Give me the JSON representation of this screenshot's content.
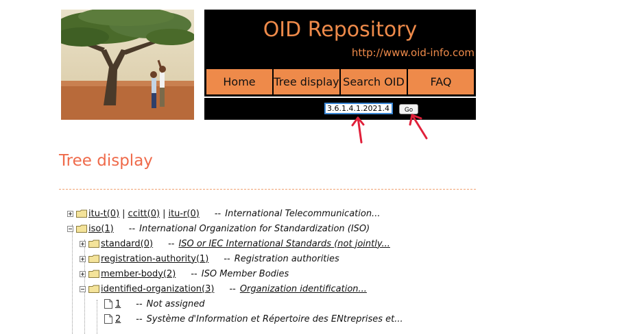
{
  "header": {
    "title": "OID Repository",
    "url": "http://www.oid-info.com"
  },
  "nav": {
    "items": [
      "Home",
      "Tree display",
      "Search OID",
      "FAQ"
    ]
  },
  "search": {
    "value": "3.6.1.4.1.2021.4.1",
    "go_label": "Go"
  },
  "page": {
    "title": "Tree display"
  },
  "tree": {
    "row0": {
      "links": [
        "itu-t(0)",
        "ccitt(0)",
        "itu-r(0)"
      ],
      "desc": "International Telecommunication..."
    },
    "row1": {
      "link": "iso(1)",
      "desc": "International Organization for Standardization (ISO)"
    },
    "row2": {
      "link": "standard(0)",
      "desc": "ISO or IEC International Standards (not jointly..."
    },
    "row3": {
      "link": "registration-authority(1)",
      "desc": "Registration authorities"
    },
    "row4": {
      "link": "member-body(2)",
      "desc": "ISO Member Bodies"
    },
    "row5": {
      "link": "identified-organization(3)",
      "desc": "Organization identification..."
    },
    "row6": {
      "link": "1",
      "desc": "Not assigned"
    },
    "row7": {
      "link": "2",
      "desc": "Système d'Information et Répertoire des ENtreprises et..."
    },
    "dash": "--"
  },
  "colors": {
    "accent": "#ee8a4a",
    "title": "#ef6a4a",
    "arrow": "#e0203a"
  }
}
